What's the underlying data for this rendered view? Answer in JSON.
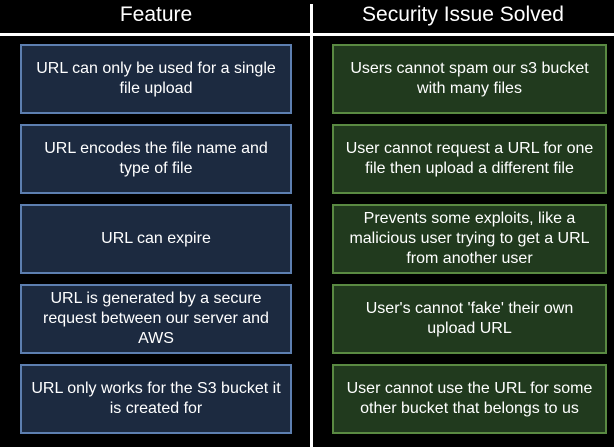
{
  "headers": {
    "feature": "Feature",
    "security": "Security Issue Solved"
  },
  "rows": [
    {
      "feature": "URL can only be used for a single file upload",
      "security": "Users cannot spam our s3 bucket with many files"
    },
    {
      "feature": "URL encodes the file name and type of file",
      "security": "User cannot request a URL for one file then upload a different file"
    },
    {
      "feature": "URL can expire",
      "security": "Prevents some exploits, like a malicious user trying to get a URL from another user"
    },
    {
      "feature": "URL is generated by a secure request between our server and AWS",
      "security": "User's cannot 'fake' their own upload URL"
    },
    {
      "feature": "URL only works for the S3 bucket it is created for",
      "security": "User cannot use the URL for some other bucket that belongs to us"
    }
  ],
  "colors": {
    "feature_fill": "#1c2a40",
    "feature_border": "#5d7fb0",
    "security_fill": "#213a1e",
    "security_border": "#5a8a42"
  }
}
